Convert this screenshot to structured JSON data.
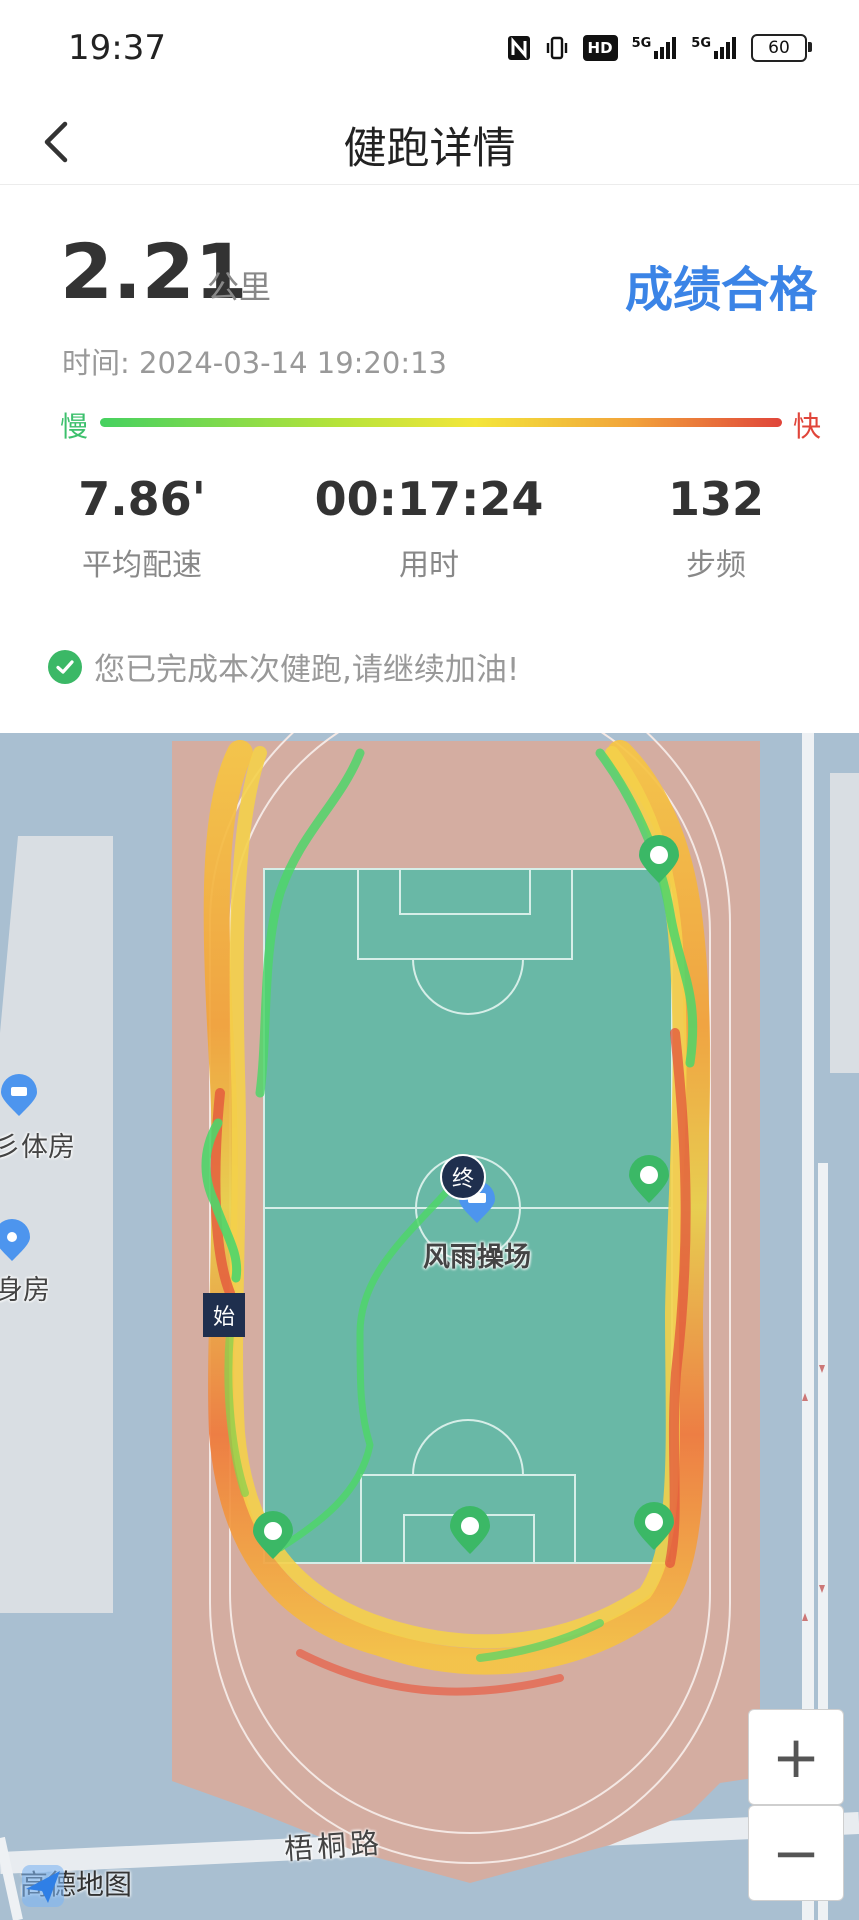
{
  "status_bar": {
    "time": "19:37",
    "icons": [
      "nfc-icon",
      "vibrate-icon",
      "hd-icon",
      "signal-5g-icon",
      "signal-5g-icon",
      "battery-icon"
    ],
    "hd_text": "HD",
    "signal_text": "5G",
    "battery": "60"
  },
  "header": {
    "title": "健跑详情",
    "back_icon": "chevron-left-icon"
  },
  "summary": {
    "distance": "2.21",
    "distance_unit": "公里",
    "grade": "成绩合格",
    "time": "时间: 2024-03-14 19:20:13",
    "speed_scale": {
      "slow": "慢",
      "fast": "快"
    }
  },
  "stats": [
    {
      "value": "7.86'",
      "label": "平均配速"
    },
    {
      "value": "00:17:24",
      "label": "用时"
    },
    {
      "value": "132",
      "label": "步频"
    }
  ],
  "completion": {
    "text": "您已完成本次健跑,请继续加油!",
    "icon": "check-circle-icon"
  },
  "map": {
    "venue": "风雨操场",
    "start": "始",
    "end": "终",
    "road": "梧桐路",
    "poi_partial_1": "彡体房",
    "poi_partial_2": "身房",
    "zoom_in": "+",
    "zoom_out": "−",
    "provider": "高德地图"
  },
  "colors": {
    "accent_blue": "#3b84e6",
    "slow_green": "#3cc06c",
    "fast_red": "#e0453a",
    "pitch_green": "#69b8a6",
    "track_brown": "#d4ada1",
    "water_blue": "#a9bfd1"
  }
}
